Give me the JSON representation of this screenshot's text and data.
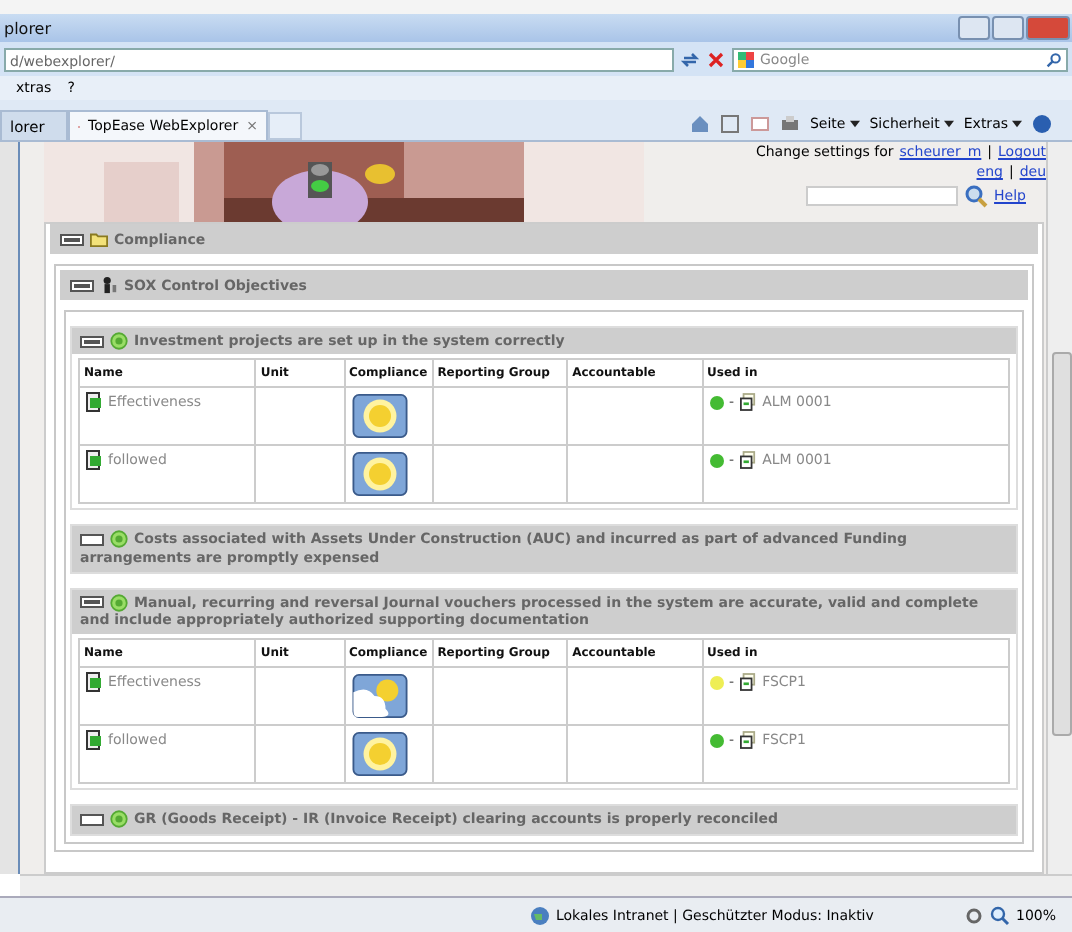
{
  "window": {
    "title": "plorer"
  },
  "address": {
    "url": "d/webexplorer/",
    "search_placeholder": "Google"
  },
  "menu": [
    "xtras",
    "?"
  ],
  "tabs": [
    {
      "label": "lorer",
      "selected": false
    },
    {
      "label": "TopEase WebExplorer",
      "selected": true,
      "close": "×"
    }
  ],
  "toolbar": [
    "Seite",
    "Sicherheit",
    "Extras"
  ],
  "header": {
    "settings_label": "Change settings for",
    "user": "scheurer_m",
    "separator": "|",
    "logout": "Logout",
    "languages": [
      "eng",
      "deu"
    ],
    "help": "Help"
  },
  "compliance": {
    "title": "Compliance",
    "expanded": true
  },
  "sox": {
    "title": "SOX Control Objectives",
    "expanded": true
  },
  "objectives": [
    {
      "title": "Investment projects are set up in the system correctly",
      "expanded": true,
      "columns": [
        "Name",
        "Unit",
        "Compliance",
        "Reporting Group",
        "Accountable",
        "Used in"
      ],
      "rows": [
        {
          "name": "Effectiveness",
          "kind": "sunny",
          "color": "#44bb33",
          "dash": "-",
          "used_in": "ALM 0001"
        },
        {
          "name": "followed",
          "kind": "sunny",
          "color": "#44bb33",
          "dash": "-",
          "used_in": "ALM 0001"
        }
      ]
    },
    {
      "title": "Costs associated with Assets Under Construction (AUC) and incurred as part of advanced Funding arrangements are promptly expensed",
      "expanded": false
    },
    {
      "title": "Manual, recurring and reversal Journal vouchers processed in the system are accurate, valid and complete and include appropriately authorized supporting documentation",
      "expanded": true,
      "columns": [
        "Name",
        "Unit",
        "Compliance",
        "Reporting Group",
        "Accountable",
        "Used in"
      ],
      "rows": [
        {
          "name": "Effectiveness",
          "kind": "partly_cloudy",
          "color": "#eeee55",
          "dash": "-",
          "used_in": "FSCP1"
        },
        {
          "name": "followed",
          "kind": "sunny",
          "color": "#44bb33",
          "dash": "-",
          "used_in": "FSCP1"
        }
      ]
    },
    {
      "title": "GR (Goods Receipt) - IR (Invoice Receipt) clearing accounts is properly reconciled",
      "expanded": false
    }
  ],
  "status_bar": {
    "zone": "Lokales Intranet | Geschützter Modus: Inaktiv",
    "zoom": "100%"
  }
}
